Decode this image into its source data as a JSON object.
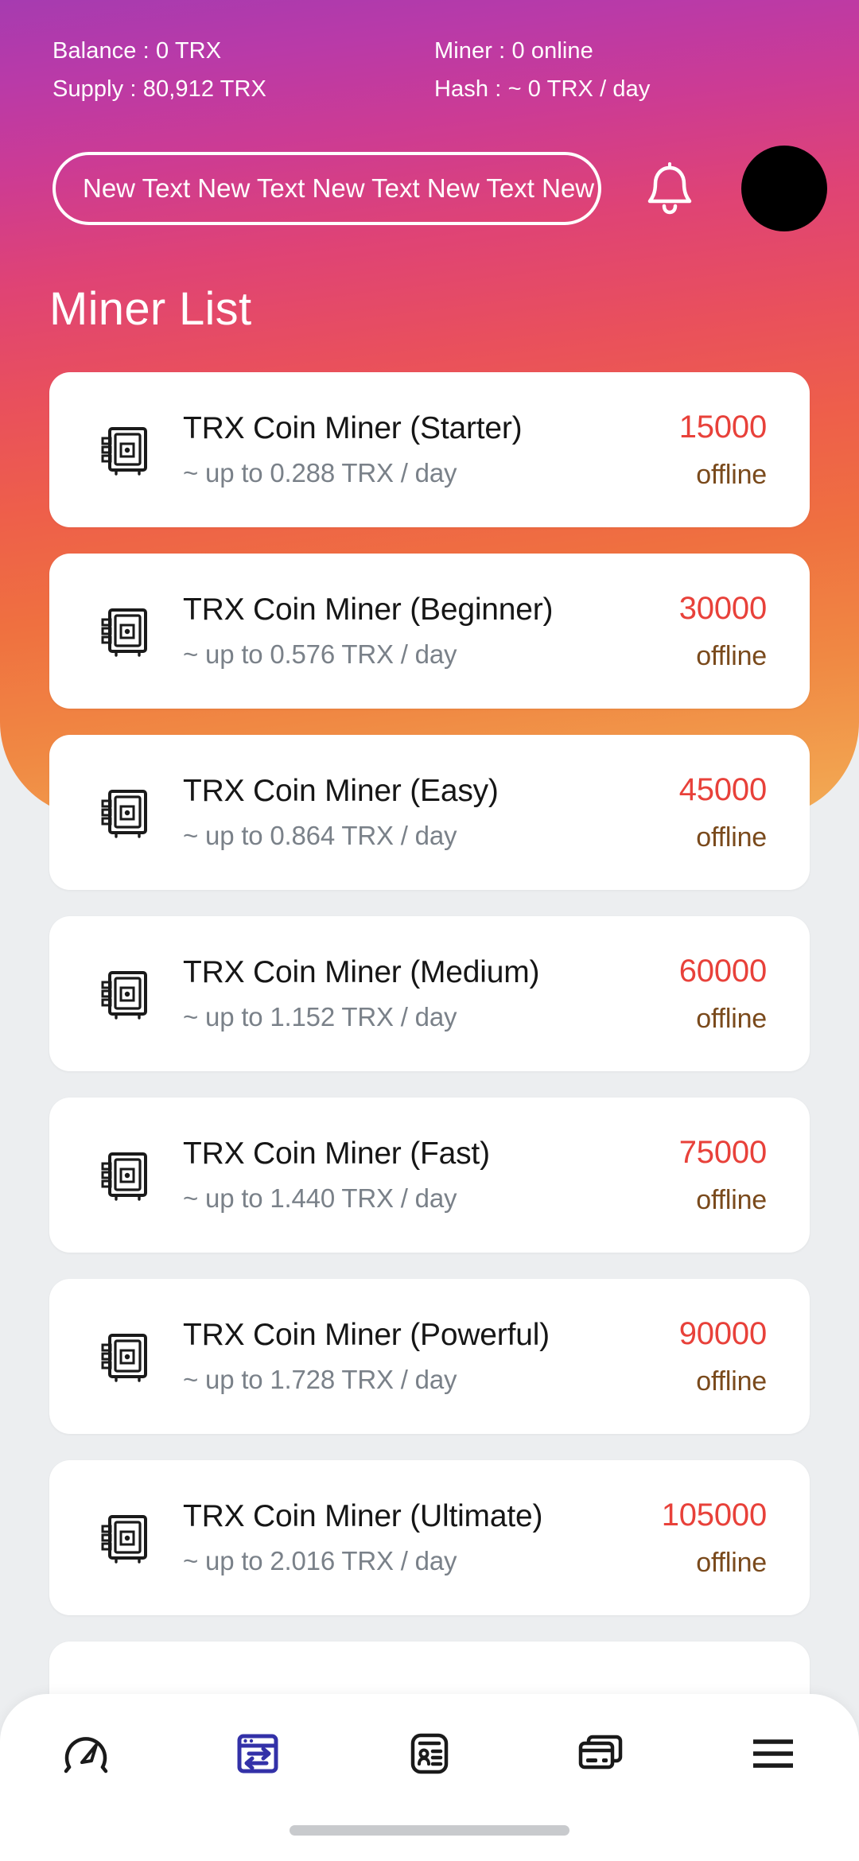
{
  "header": {
    "stats": [
      {
        "left": "Balance : 0 TRX",
        "right": "Miner : 0 online"
      },
      {
        "left": "Supply : 80,912 TRX",
        "right": "Hash : ~ 0 TRX / day"
      }
    ],
    "marquee_text": "New Text New Text New Text New Text New Text",
    "bell_icon": "bell-icon",
    "avatar_icon": "avatar",
    "gradient_start": "#a63bb0",
    "gradient_mid": "#e9505c",
    "gradient_end": "#f3ad57"
  },
  "page": {
    "title": "Miner List"
  },
  "miners": [
    {
      "icon": "miner-rig-icon",
      "name": "TRX Coin Miner (Starter)",
      "rate": "~ up to 0.288 TRX / day",
      "price": "15000",
      "status": "offline"
    },
    {
      "icon": "miner-rig-icon",
      "name": "TRX Coin Miner (Beginner)",
      "rate": "~ up to 0.576 TRX / day",
      "price": "30000",
      "status": "offline"
    },
    {
      "icon": "miner-rig-icon",
      "name": "TRX Coin Miner (Easy)",
      "rate": "~ up to 0.864 TRX / day",
      "price": "45000",
      "status": "offline"
    },
    {
      "icon": "miner-rig-icon",
      "name": "TRX Coin Miner (Medium)",
      "rate": "~ up to 1.152 TRX / day",
      "price": "60000",
      "status": "offline"
    },
    {
      "icon": "miner-rig-icon",
      "name": "TRX Coin Miner (Fast)",
      "rate": "~ up to 1.440 TRX / day",
      "price": "75000",
      "status": "offline"
    },
    {
      "icon": "miner-rig-icon",
      "name": "TRX Coin Miner (Powerful)",
      "rate": "~ up to 1.728 TRX / day",
      "price": "90000",
      "status": "offline"
    },
    {
      "icon": "miner-rig-icon",
      "name": "TRX Coin Miner (Ultimate)",
      "rate": "~ up to 2.016 TRX / day",
      "price": "105000",
      "status": "offline"
    }
  ],
  "colors": {
    "price": "#e8413a",
    "status": "#7a4a1c",
    "rate": "#7a8189",
    "name": "#161616",
    "nav_active": "#3party",
    "nav_active_color": "#3331a8",
    "nav_inactive_color": "#1a1a1a",
    "card_bg": "#ffffff",
    "page_bg": "#eceef0"
  },
  "bottom_nav": {
    "items": [
      {
        "icon": "speedometer-icon",
        "active": false
      },
      {
        "icon": "exchange-window-icon",
        "active": true
      },
      {
        "icon": "id-card-icon",
        "active": false
      },
      {
        "icon": "credit-cards-icon",
        "active": false
      },
      {
        "icon": "hamburger-menu-icon",
        "active": false
      }
    ]
  }
}
